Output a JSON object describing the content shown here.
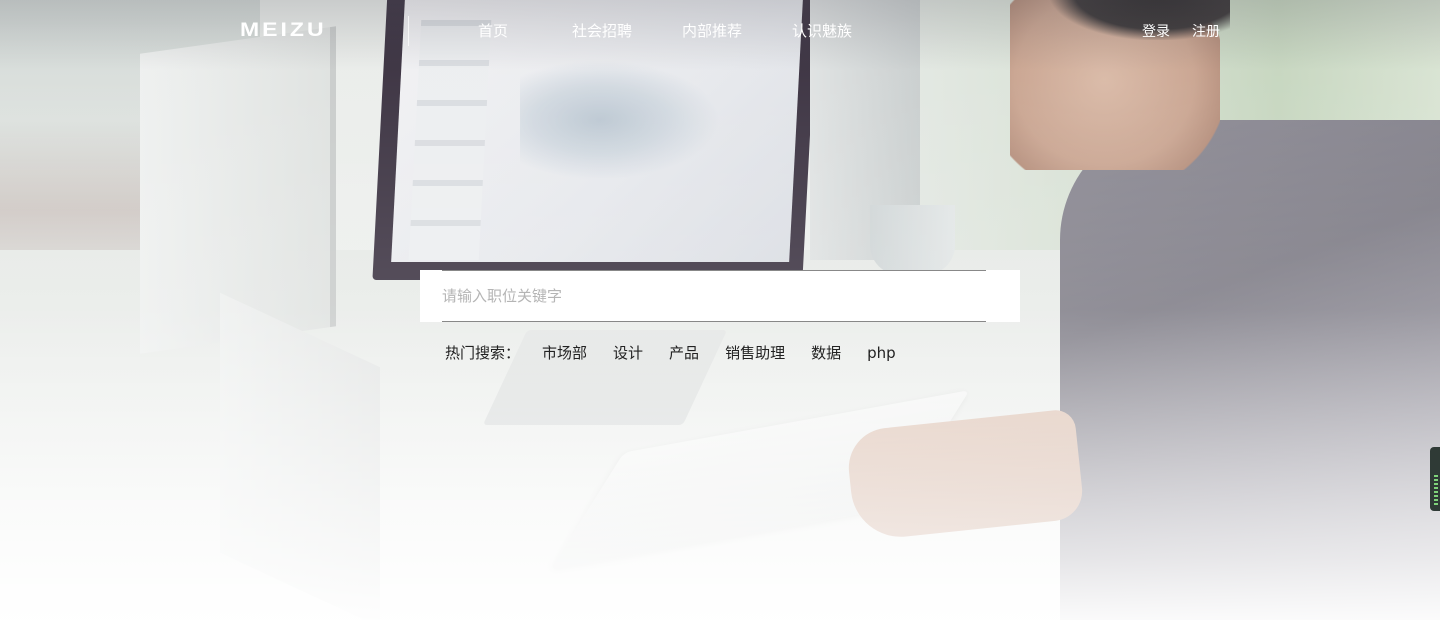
{
  "header": {
    "logo": "MEIZU",
    "nav": [
      {
        "label": "首页"
      },
      {
        "label": "社会招聘"
      },
      {
        "label": "内部推荐"
      },
      {
        "label": "认识魅族"
      }
    ],
    "auth": {
      "login": "登录",
      "register": "注册"
    }
  },
  "search": {
    "placeholder": "请输入职位关键字",
    "value": ""
  },
  "hot_search": {
    "label": "热门搜索：",
    "items": [
      "市场部",
      "设计",
      "产品",
      "销售助理",
      "数据",
      "php"
    ]
  },
  "colors": {
    "nav_text": "#ffffff",
    "search_bg": "#ffffff",
    "hot_text": "#222222"
  }
}
